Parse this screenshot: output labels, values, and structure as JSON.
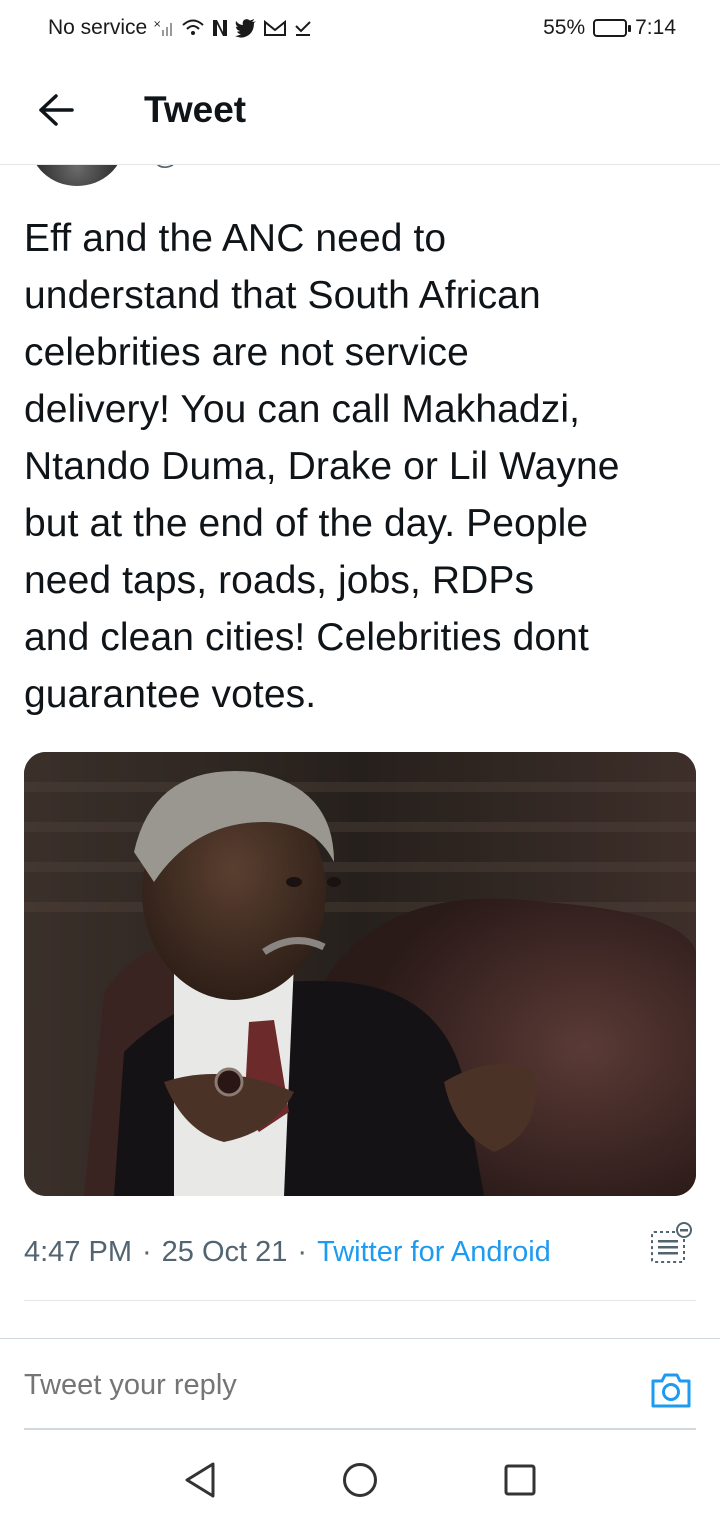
{
  "status_bar": {
    "carrier": "No service",
    "battery_percent": "55%",
    "battery_level": 0.55,
    "time": "7:14",
    "icons": [
      "signal-off-icon",
      "wifi-icon",
      "netflix-icon",
      "twitter-icon",
      "gmail-icon",
      "download-done-icon"
    ]
  },
  "header": {
    "title": "Tweet",
    "back_icon": "arrow-left-icon"
  },
  "tweet": {
    "text": "Eff and the ANC need to\nunderstand that South African\ncelebrities are not service\ndelivery! You can call Makhadzi,\nNtando Duma, Drake or Lil Wayne\nbut at the end of the day. People\nneed taps, roads, jobs, RDPs\nand clean cities! Celebrities dont\nguarantee votes.",
    "time": "4:47 PM",
    "date": "25 Oct 21",
    "source": "Twitter for Android",
    "separator": "·",
    "photo_alt": "photo"
  },
  "reply": {
    "placeholder": "Tweet your reply"
  },
  "colors": {
    "text_primary": "#0f1419",
    "text_secondary": "#536471",
    "accent": "#1d9bf0",
    "divider": "#e2e6e9"
  }
}
